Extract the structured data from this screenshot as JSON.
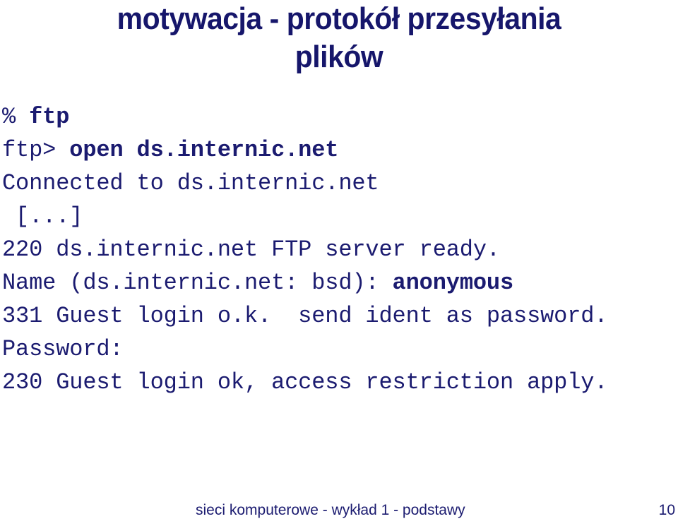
{
  "slide": {
    "title_lines": [
      "motywacja - protokół przesyłania",
      "plików"
    ],
    "accent_color": "#16166b",
    "body_color": "#1b1b70",
    "background_color": "#ffffff"
  },
  "transcript": {
    "lines": [
      {
        "prefix": "% ",
        "command": "ftp"
      },
      {
        "prefix": "ftp> ",
        "command": "open ds.internic.net"
      },
      {
        "prefix": "Connected to ds.internic.net",
        "command": ""
      },
      {
        "prefix": " [...]",
        "command": ""
      },
      {
        "prefix": "220 ds.internic.net FTP server ready.",
        "command": ""
      },
      {
        "prefix": "Name (ds.internic.net: bsd): ",
        "command": "anonymous"
      },
      {
        "prefix": "331 Guest login o.k.  send ident as password.",
        "command": ""
      },
      {
        "prefix": "Password:",
        "command": ""
      },
      {
        "prefix": "230 Guest login ok, access restriction apply.",
        "command": ""
      }
    ]
  },
  "footer": {
    "text": "sieci komputerowe - wykład 1 - podstawy",
    "page_number": "10"
  }
}
